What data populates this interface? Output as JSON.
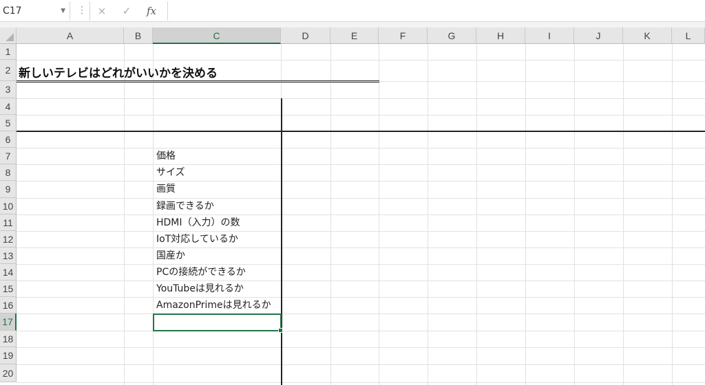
{
  "formula_bar": {
    "name_box": "C17",
    "cancel_icon": "×",
    "enter_icon": "✓",
    "fx_label": "fx",
    "formula": ""
  },
  "columns": [
    "A",
    "B",
    "C",
    "D",
    "E",
    "F",
    "G",
    "H",
    "I",
    "J",
    "K",
    "L"
  ],
  "selected_column": "C",
  "rows": [
    "1",
    "2",
    "3",
    "4",
    "5",
    "6",
    "7",
    "8",
    "9",
    "10",
    "11",
    "12",
    "13",
    "14",
    "15",
    "16",
    "17",
    "18",
    "19",
    "20"
  ],
  "selected_row": "17",
  "sheet": {
    "title": "新しいテレビはどれがいいかを決める",
    "criteria": [
      "価格",
      "サイズ",
      "画質",
      "録画できるか",
      "HDMI（入力）の数",
      "IoT対応しているか",
      "国産か",
      "PCの接続ができるか",
      "YouTubeは見れるか",
      "AmazonPrimeは見れるか"
    ]
  },
  "colors": {
    "accent": "#217346",
    "grid": "#e1e1e1",
    "header_bg": "#e6e6e6"
  }
}
